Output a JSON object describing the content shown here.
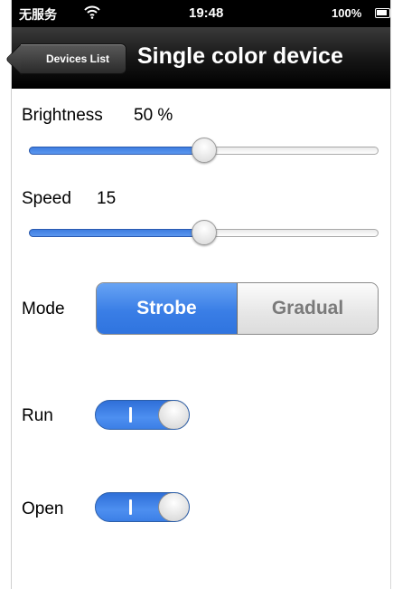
{
  "status_bar": {
    "carrier": "无服务",
    "time": "19:48",
    "battery": "100%",
    "wifi_icon": "wifi-icon",
    "battery_icon": "battery-icon"
  },
  "nav": {
    "back_label": "Devices List",
    "title": "Single color device"
  },
  "brightness": {
    "label": "Brightness",
    "value_text": "50 %",
    "level": 0.5
  },
  "speed": {
    "label": "Speed",
    "value_text": "15",
    "level": 0.5
  },
  "mode": {
    "label": "Mode",
    "options": [
      "Strobe",
      "Gradual"
    ],
    "selected": "Strobe"
  },
  "run": {
    "label": "Run",
    "state": "on"
  },
  "open": {
    "label": "Open",
    "state": "on"
  },
  "colors": {
    "accent": "#3a7ee6",
    "navbar": "#151515"
  }
}
